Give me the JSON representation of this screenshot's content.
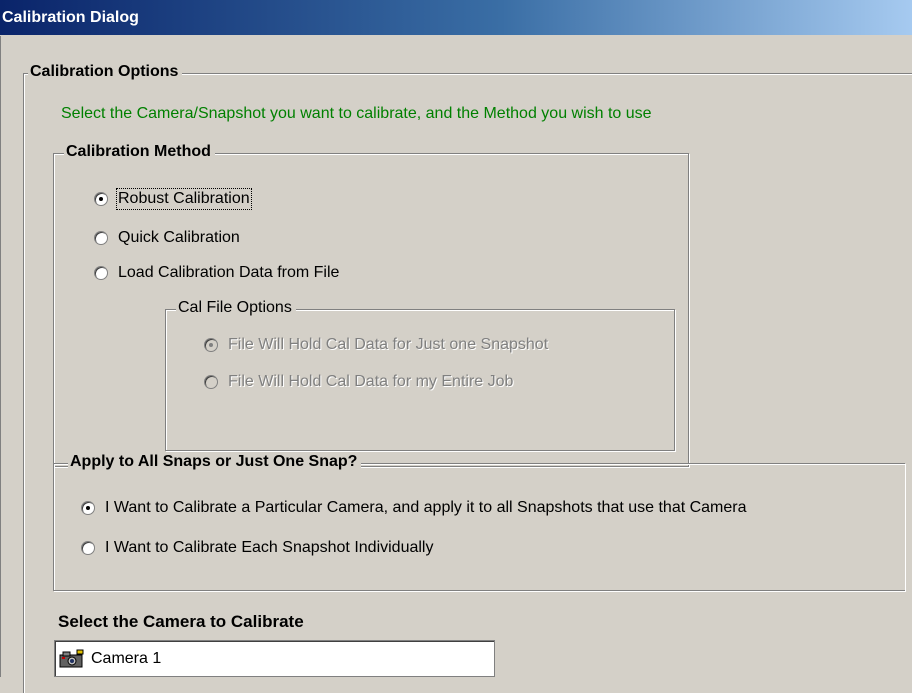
{
  "window": {
    "title": "Calibration Dialog"
  },
  "calibration_options": {
    "legend": "Calibration Options",
    "instruction": "Select the Camera/Snapshot you want to calibrate, and the Method you wish to use",
    "instruction_color": "#008000"
  },
  "calibration_method": {
    "legend": "Calibration Method",
    "options": [
      {
        "label": "Robust Calibration",
        "checked": true
      },
      {
        "label": "Quick Calibration",
        "checked": false
      },
      {
        "label": "Load Calibration Data from File",
        "checked": false
      }
    ],
    "cal_file_options": {
      "legend": "Cal File Options",
      "enabled": false,
      "options": [
        {
          "label": "File Will Hold Cal Data for Just one Snapshot",
          "checked": true
        },
        {
          "label": "File Will Hold Cal Data for my Entire Job",
          "checked": false
        }
      ]
    }
  },
  "apply_scope": {
    "legend": "Apply to All Snaps or Just One Snap?",
    "options": [
      {
        "label": "I Want to Calibrate a Particular Camera, and apply it to all Snapshots that use that Camera",
        "checked": true
      },
      {
        "label": "I Want to Calibrate Each Snapshot Individually",
        "checked": false
      }
    ]
  },
  "camera_select": {
    "label": "Select the Camera to Calibrate",
    "items": [
      {
        "label": "Camera 1",
        "icon": "camera-icon"
      }
    ]
  },
  "colors": {
    "title_gradient_start": "#0a246a",
    "title_gradient_end": "#a6caf0",
    "dialog_background": "#d4d0c8",
    "disabled_text": "#808080"
  }
}
